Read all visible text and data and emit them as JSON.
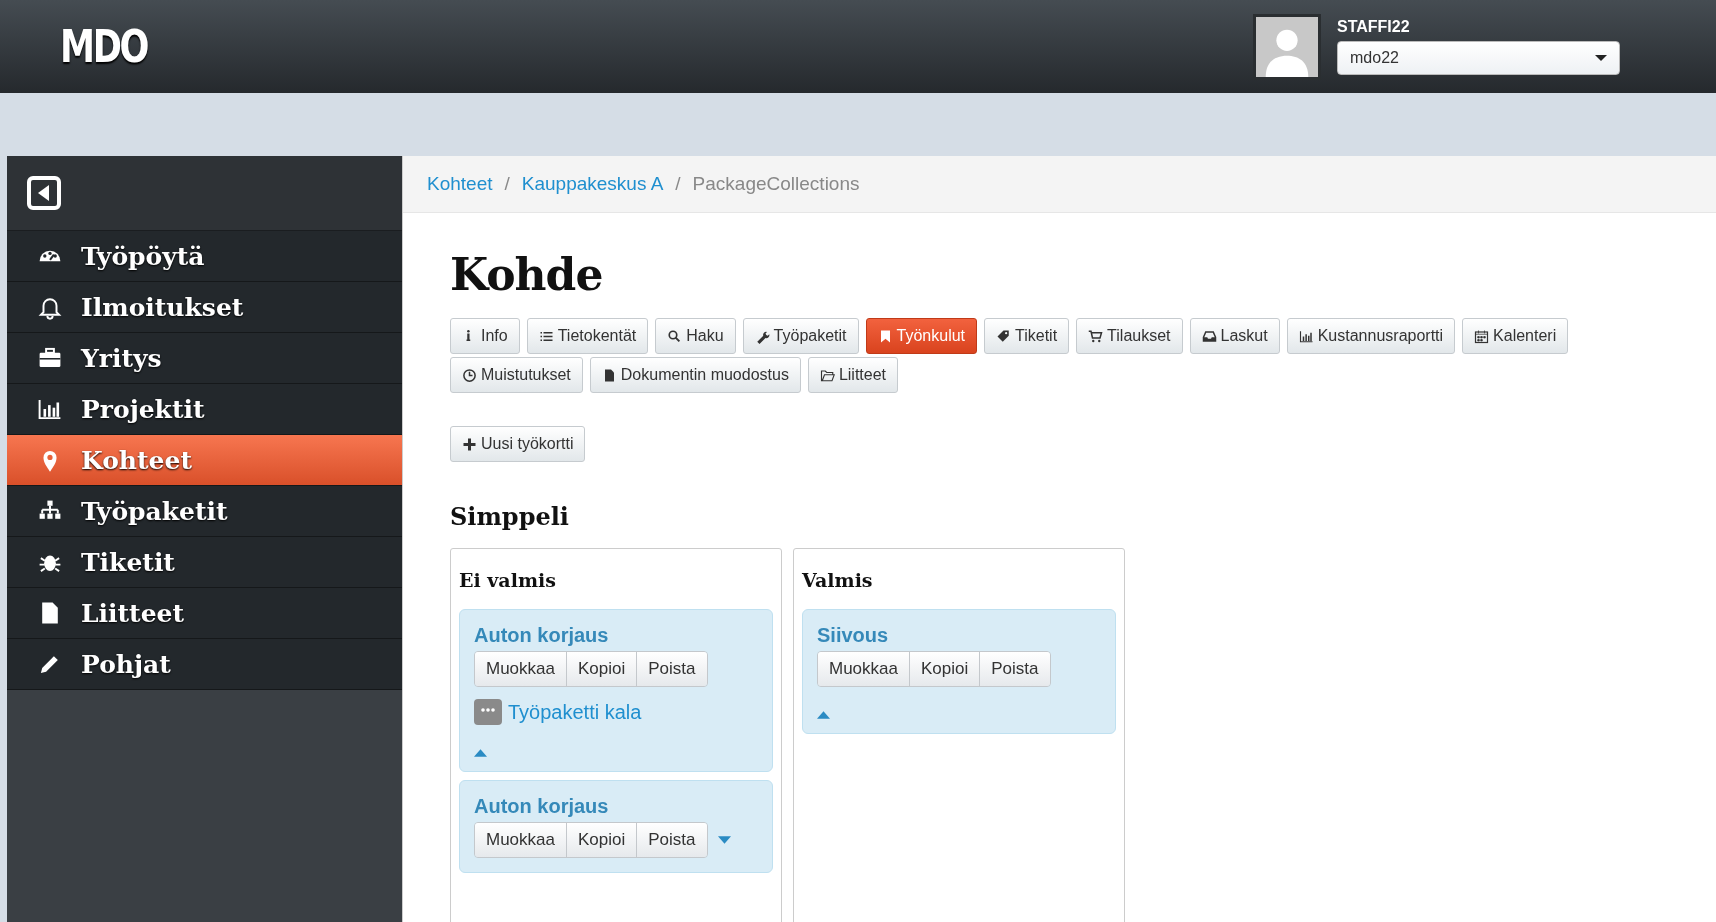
{
  "header": {
    "logo": "MDO",
    "user": "STAFFI22",
    "account_select": "mdo22"
  },
  "sidebar": {
    "items": [
      {
        "label": "Työpöytä",
        "selected": false
      },
      {
        "label": "Ilmoitukset",
        "selected": false
      },
      {
        "label": "Yritys",
        "selected": false
      },
      {
        "label": "Projektit",
        "selected": false
      },
      {
        "label": "Kohteet",
        "selected": true
      },
      {
        "label": "Työpaketit",
        "selected": false
      },
      {
        "label": "Tiketit",
        "selected": false
      },
      {
        "label": "Liitteet",
        "selected": false
      },
      {
        "label": "Pohjat",
        "selected": false
      }
    ]
  },
  "breadcrumb": {
    "separator": "/",
    "items": [
      "Kohteet",
      "Kauppakeskus A",
      "PackageCollections"
    ]
  },
  "title": "Kohde",
  "tabs": [
    {
      "label": "Info",
      "selected": false
    },
    {
      "label": "Tietokentät",
      "selected": false
    },
    {
      "label": "Haku",
      "selected": false
    },
    {
      "label": "Työpaketit",
      "selected": false
    },
    {
      "label": "Työnkulut",
      "selected": true
    },
    {
      "label": "Tiketit",
      "selected": false
    },
    {
      "label": "Tilaukset",
      "selected": false
    },
    {
      "label": "Laskut",
      "selected": false
    },
    {
      "label": "Kustannusraportti",
      "selected": false
    },
    {
      "label": "Kalenteri",
      "selected": false
    },
    {
      "label": "Muistutukset",
      "selected": false
    },
    {
      "label": "Dokumentin muodostus",
      "selected": false
    },
    {
      "label": "Liitteet",
      "selected": false
    }
  ],
  "new_button": "Uusi työkortti",
  "section_title": "Simppeli",
  "columns": [
    {
      "title": "Ei valmis",
      "cards": [
        {
          "title": "Auton korjaus",
          "actions": [
            "Muokkaa",
            "Kopioi",
            "Poista"
          ],
          "expanded": true,
          "children": [
            {
              "label": "Työpaketti kala"
            }
          ]
        },
        {
          "title": "Auton korjaus",
          "actions": [
            "Muokkaa",
            "Kopioi",
            "Poista"
          ],
          "expanded": false
        }
      ]
    },
    {
      "title": "Valmis",
      "cards": [
        {
          "title": "Siivous",
          "actions": [
            "Muokkaa",
            "Kopioi",
            "Poista"
          ],
          "expanded": true
        }
      ]
    }
  ]
}
